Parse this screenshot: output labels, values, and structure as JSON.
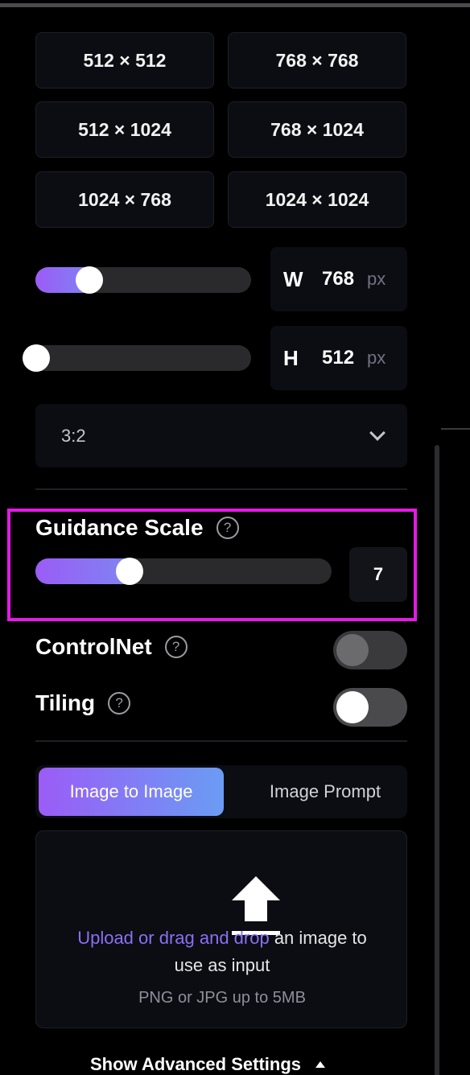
{
  "presets": [
    {
      "label": "512 × 512"
    },
    {
      "label": "768 × 768"
    },
    {
      "label": "512 × 1024"
    },
    {
      "label": "768 × 1024"
    },
    {
      "label": "1024 × 768"
    },
    {
      "label": "1024 × 1024"
    }
  ],
  "width": {
    "letter": "W",
    "value": "768",
    "unit": "px",
    "slider_fraction": 0.25
  },
  "height": {
    "letter": "H",
    "value": "512",
    "unit": "px",
    "slider_fraction": 0.0
  },
  "aspect_ratio": {
    "value": "3:2"
  },
  "guidance_scale": {
    "label": "Guidance Scale",
    "help": "?",
    "value": "7",
    "slider_fraction": 0.32
  },
  "controlnet": {
    "label": "ControlNet",
    "help": "?",
    "enabled": false
  },
  "tiling": {
    "label": "Tiling",
    "help": "?",
    "enabled": true
  },
  "tabs": {
    "active": "Image to Image",
    "inactive": "Image Prompt"
  },
  "upload": {
    "link_text": "Upload or drag and drop",
    "text_after": " an image to",
    "text_line2": "use as input",
    "hint": "PNG or JPG up to 5MB"
  },
  "advanced": {
    "label": "Show Advanced Settings"
  },
  "colors": {
    "accent_start": "#9b5cf6",
    "accent_end": "#6a9cf4",
    "highlight": "#e619e6"
  }
}
